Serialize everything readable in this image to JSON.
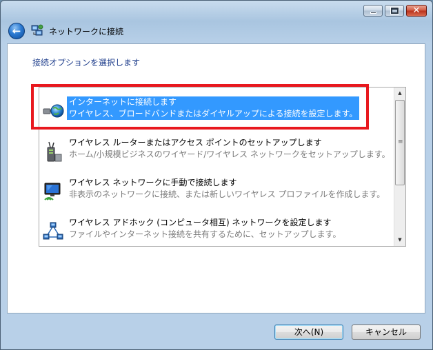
{
  "window": {
    "title": "ネットワークに接続",
    "close_glyph": "✕"
  },
  "header": {
    "back_glyph": "←"
  },
  "content": {
    "subtitle": "接続オプションを選択します",
    "options": [
      {
        "title": "インターネットに接続します",
        "description": "ワイヤレス、ブロードバンドまたはダイヤルアップによる接続を設定します。",
        "icon": "globe-network-icon",
        "selected": true
      },
      {
        "title": "ワイヤレス ルーターまたはアクセス ポイントのセットアップします",
        "description": "ホーム/小規模ビジネスのワイヤード/ワイヤレス ネットワークをセットアップします。",
        "icon": "router-icon",
        "selected": false
      },
      {
        "title": "ワイヤレス ネットワークに手動で接続します",
        "description": "非表示のネットワークに接続、または新しいワイヤレス プロファイルを作成します。",
        "icon": "monitor-wireless-icon",
        "selected": false
      },
      {
        "title": "ワイヤレス アドホック (コンピュータ相互) ネットワークを設定します",
        "description": "ファイルやインターネット接続を共有するために、セットアップします。",
        "icon": "adhoc-network-icon",
        "selected": false
      }
    ]
  },
  "scrollbar": {
    "up_glyph": "▲",
    "down_glyph": "▼",
    "grip_glyph": "≡"
  },
  "buttons": {
    "next_label": "次へ(N)",
    "cancel_label": "キャンセル"
  },
  "colors": {
    "selection": "#3399ff",
    "highlight_border": "#e8181e",
    "subtitle_text": "#1f3e8c"
  }
}
